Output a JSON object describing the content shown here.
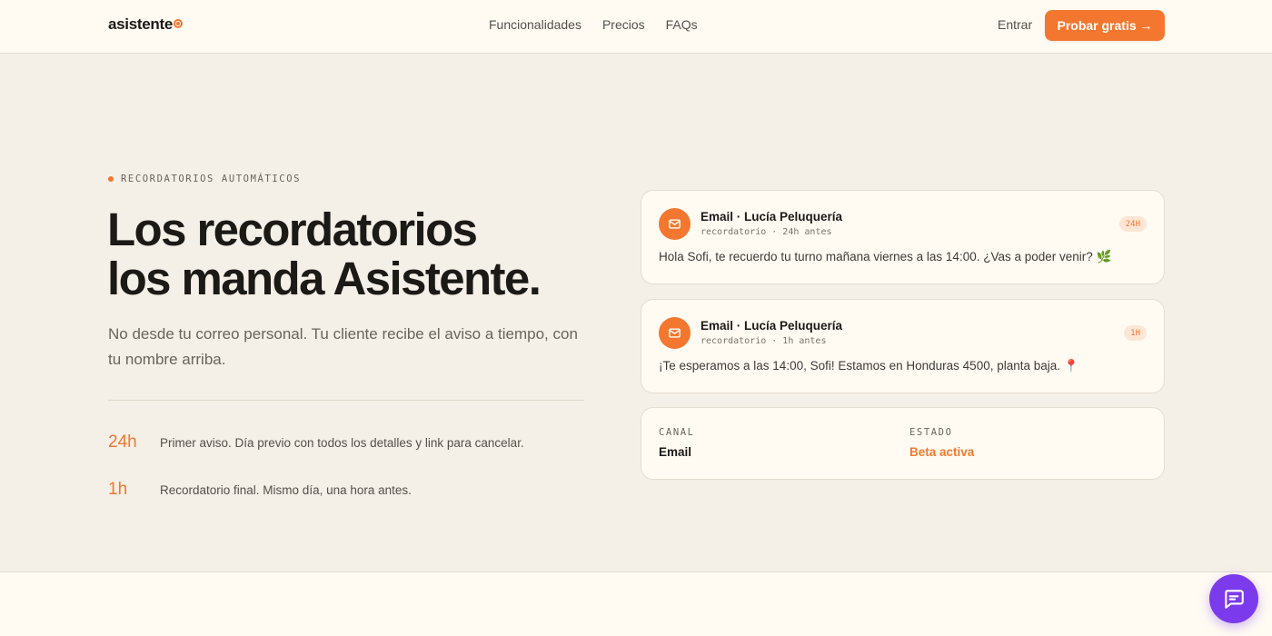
{
  "header": {
    "logo": "asistente",
    "nav": [
      "Funcionalidades",
      "Precios",
      "FAQs"
    ],
    "login": "Entrar",
    "cta": "Probar gratis →"
  },
  "hero": {
    "eyebrow": "RECORDATORIOS AUTOMÁTICOS",
    "headline_line1": "Los recordatorios",
    "headline_line2": "los manda Asistente.",
    "subtitle": "No desde tu correo personal. Tu cliente recibe el aviso a tiempo, con tu nombre arriba.",
    "steps": [
      {
        "time": "24h",
        "text": "Primer aviso. Día previo con todos los detalles y link para cancelar."
      },
      {
        "time": "1h",
        "text": "Recordatorio final. Mismo día, una hora antes."
      }
    ]
  },
  "messages": [
    {
      "title": "Email · Lucía Peluquería",
      "meta": "recordatorio · 24h antes",
      "badge": "24H",
      "body": "Hola Sofi, te recuerdo tu turno mañana viernes a las 14:00. ¿Vas a poder venir? 🌿",
      "icon": "mail-icon"
    },
    {
      "title": "Email · Lucía Peluquería",
      "meta": "recordatorio · 1h antes",
      "badge": "1H",
      "body": "¡Te esperamos a las 14:00, Sofi! Estamos en Honduras 4500, planta baja. 📍",
      "icon": "mail-icon"
    }
  ],
  "info": {
    "canal_label": "CANAL",
    "canal_value": "Email",
    "estado_label": "ESTADO",
    "estado_value": "Beta activa"
  },
  "colors": {
    "accent": "#f4772f",
    "background": "#f4efe7",
    "surface": "#fffbf3",
    "chat": "#7c3aed"
  },
  "chat_widget": {
    "icon": "chat-bubble-icon"
  }
}
